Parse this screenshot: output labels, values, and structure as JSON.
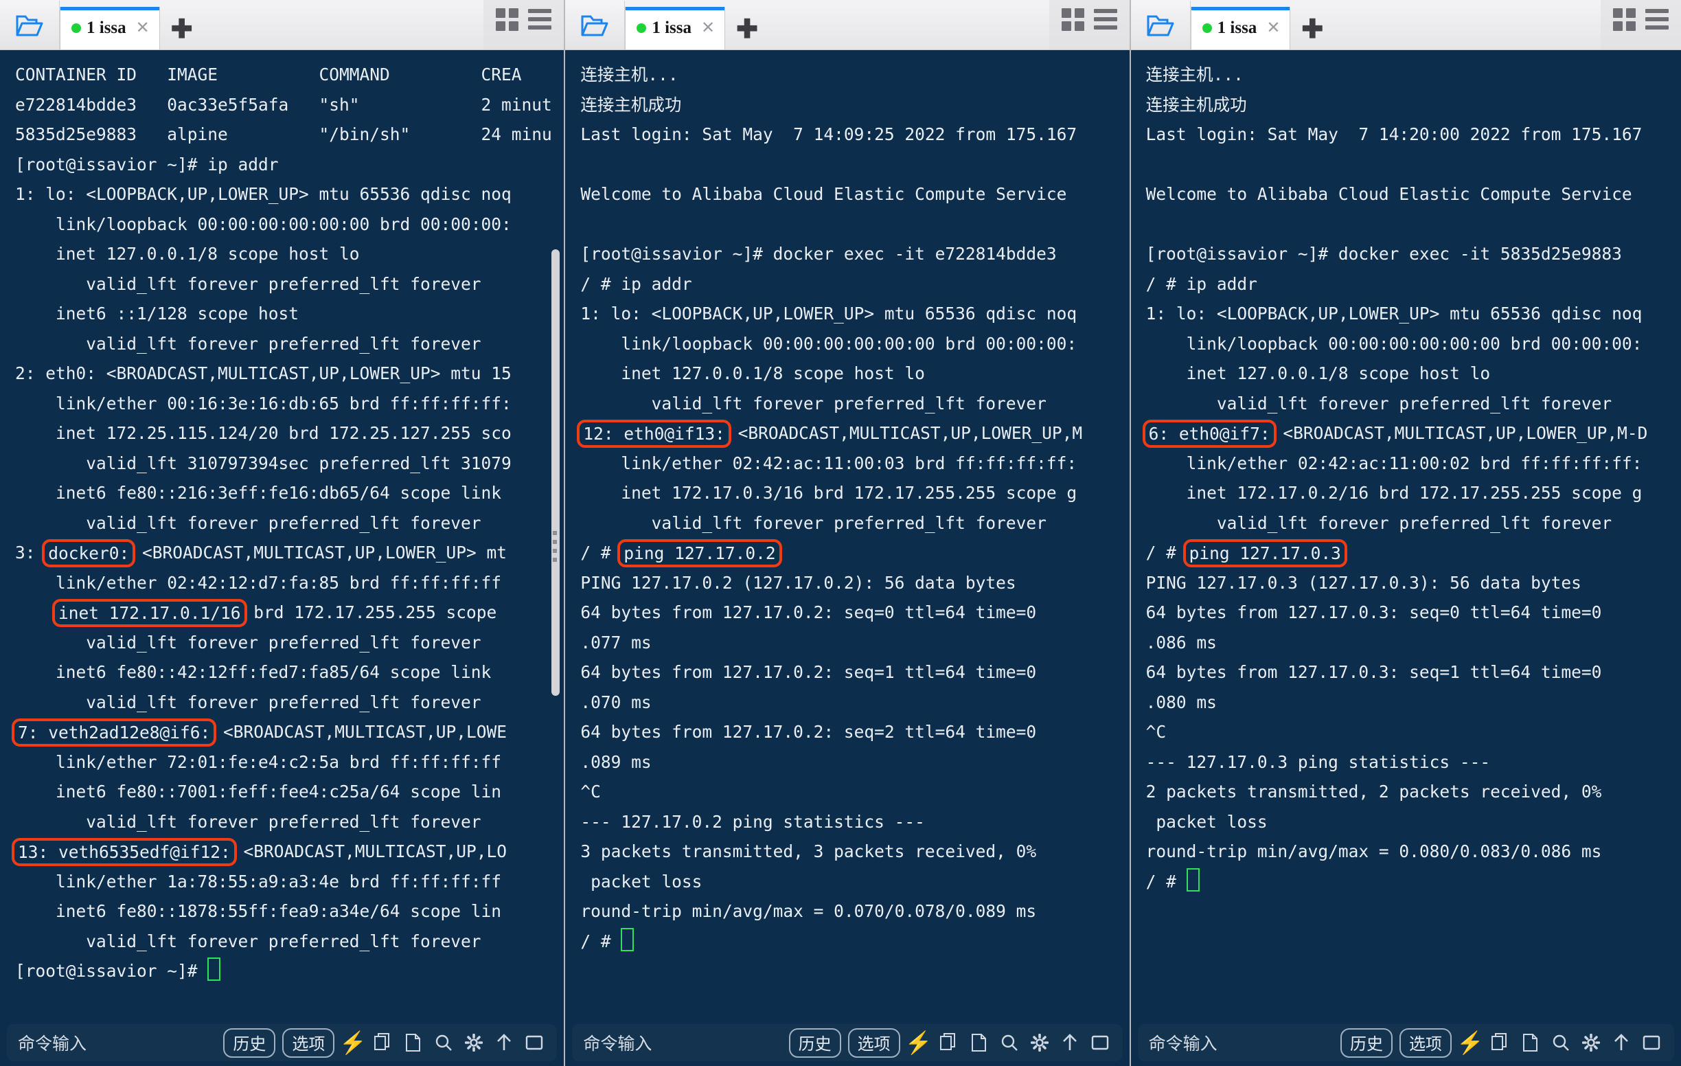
{
  "window": {
    "panel_count": 3
  },
  "tab": {
    "label": "1 issa",
    "close_glyph": "✕",
    "add_glyph": "✚",
    "folder_icon": "folder-open-icon",
    "dot_status": "connected",
    "accent_color": "#1a84f0",
    "status_color": "#1fd235"
  },
  "bottombar": {
    "placeholder": "命令输入",
    "history_label": "历史",
    "options_label": "选项",
    "icons": [
      "bolt-icon",
      "copy-icon",
      "paste-icon",
      "search-icon",
      "gear-icon",
      "upload-icon",
      "window-icon"
    ]
  },
  "panels": [
    {
      "id": "panel-host",
      "lines": [
        [
          {
            "t": "CONTAINER ID   IMAGE          COMMAND         CREA"
          }
        ],
        [
          {
            "t": "e722814bdde3   0ac33e5f5afa   \"sh\"            2 minut"
          }
        ],
        [
          {
            "t": "5835d25e9883   alpine         \"/bin/sh\"       24 minu"
          }
        ],
        [
          {
            "t": "[root@issavior ~]# ip addr"
          }
        ],
        [
          {
            "t": "1: lo: <LOOPBACK,UP,LOWER_UP> mtu 65536 qdisc noq"
          }
        ],
        [
          {
            "t": "    link/loopback 00:00:00:00:00:00 brd 00:00:00:"
          }
        ],
        [
          {
            "t": "    inet 127.0.0.1/8 scope host lo"
          }
        ],
        [
          {
            "t": "       valid_lft forever preferred_lft forever"
          }
        ],
        [
          {
            "t": "    inet6 ::1/128 scope host"
          }
        ],
        [
          {
            "t": "       valid_lft forever preferred_lft forever"
          }
        ],
        [
          {
            "t": "2: eth0: <BROADCAST,MULTICAST,UP,LOWER_UP> mtu 15"
          }
        ],
        [
          {
            "t": "    link/ether 00:16:3e:16:db:65 brd ff:ff:ff:ff:"
          }
        ],
        [
          {
            "t": "    inet 172.25.115.124/20 brd 172.25.127.255 sco"
          }
        ],
        [
          {
            "t": "       valid_lft 310797394sec preferred_lft 31079"
          }
        ],
        [
          {
            "t": "    inet6 fe80::216:3eff:fe16:db65/64 scope link"
          }
        ],
        [
          {
            "t": "       valid_lft forever preferred_lft forever"
          }
        ],
        [
          {
            "t": "3: "
          },
          {
            "t": "docker0:",
            "hl": true
          },
          {
            "t": " <BROADCAST,MULTICAST,UP,LOWER_UP> mt"
          }
        ],
        [
          {
            "t": "    link/ether 02:42:12:d7:fa:85 brd ff:ff:ff:ff"
          }
        ],
        [
          {
            "t": "    "
          },
          {
            "t": "inet 172.17.0.1/16",
            "hl": true
          },
          {
            "t": " brd 172.17.255.255 scope"
          }
        ],
        [
          {
            "t": "       valid_lft forever preferred_lft forever"
          }
        ],
        [
          {
            "t": "    inet6 fe80::42:12ff:fed7:fa85/64 scope link"
          }
        ],
        [
          {
            "t": "       valid_lft forever preferred_lft forever"
          }
        ],
        [
          {
            "t": "7: veth2ad12e8@if6:",
            "hl": true
          },
          {
            "t": " <BROADCAST,MULTICAST,UP,LOWE"
          }
        ],
        [
          {
            "t": "    link/ether 72:01:fe:e4:c2:5a brd ff:ff:ff:ff"
          }
        ],
        [
          {
            "t": "    inet6 fe80::7001:feff:fee4:c25a/64 scope lin"
          }
        ],
        [
          {
            "t": "       valid_lft forever preferred_lft forever"
          }
        ],
        [
          {
            "t": "13: veth6535edf@if12:",
            "hl": true
          },
          {
            "t": " <BROADCAST,MULTICAST,UP,LO"
          }
        ],
        [
          {
            "t": "    link/ether 1a:78:55:a9:a3:4e brd ff:ff:ff:ff"
          }
        ],
        [
          {
            "t": "    inet6 fe80::1878:55ff:fea9:a34e/64 scope lin"
          }
        ],
        [
          {
            "t": "       valid_lft forever preferred_lft forever"
          }
        ],
        [
          {
            "t": "[root@issavior ~]# "
          },
          {
            "cursor": true
          }
        ]
      ]
    },
    {
      "id": "panel-container-e722814bdde3",
      "lines": [
        [
          {
            "t": "连接主机..."
          }
        ],
        [
          {
            "t": "连接主机成功"
          }
        ],
        [
          {
            "t": "Last login: Sat May  7 14:09:25 2022 from 175.167"
          }
        ],
        [
          {
            "t": ""
          }
        ],
        [
          {
            "t": "Welcome to Alibaba Cloud Elastic Compute Service"
          }
        ],
        [
          {
            "t": ""
          }
        ],
        [
          {
            "t": "[root@issavior ~]# docker exec -it e722814bdde3"
          }
        ],
        [
          {
            "t": "/ # ip addr"
          }
        ],
        [
          {
            "t": "1: lo: <LOOPBACK,UP,LOWER_UP> mtu 65536 qdisc noq"
          }
        ],
        [
          {
            "t": "    link/loopback 00:00:00:00:00:00 brd 00:00:00:"
          }
        ],
        [
          {
            "t": "    inet 127.0.0.1/8 scope host lo"
          }
        ],
        [
          {
            "t": "       valid_lft forever preferred_lft forever"
          }
        ],
        [
          {
            "t": "12: eth0@if13:",
            "hl": true
          },
          {
            "t": " <BROADCAST,MULTICAST,UP,LOWER_UP,M"
          }
        ],
        [
          {
            "t": "    link/ether 02:42:ac:11:00:03 brd ff:ff:ff:ff:"
          }
        ],
        [
          {
            "t": "    inet 172.17.0.3/16 brd 172.17.255.255 scope g"
          }
        ],
        [
          {
            "t": "       valid_lft forever preferred_lft forever"
          }
        ],
        [
          {
            "t": "/ # "
          },
          {
            "t": "ping 127.17.0.2",
            "hl": true
          }
        ],
        [
          {
            "t": "PING 127.17.0.2 (127.17.0.2): 56 data bytes"
          }
        ],
        [
          {
            "t": "64 bytes from 127.17.0.2: seq=0 ttl=64 time=0"
          }
        ],
        [
          {
            "t": ".077 ms"
          }
        ],
        [
          {
            "t": "64 bytes from 127.17.0.2: seq=1 ttl=64 time=0"
          }
        ],
        [
          {
            "t": ".070 ms"
          }
        ],
        [
          {
            "t": "64 bytes from 127.17.0.2: seq=2 ttl=64 time=0"
          }
        ],
        [
          {
            "t": ".089 ms"
          }
        ],
        [
          {
            "t": "^C"
          }
        ],
        [
          {
            "t": "--- 127.17.0.2 ping statistics ---"
          }
        ],
        [
          {
            "t": "3 packets transmitted, 3 packets received, 0%"
          }
        ],
        [
          {
            "t": " packet loss"
          }
        ],
        [
          {
            "t": "round-trip min/avg/max = 0.070/0.078/0.089 ms"
          }
        ],
        [
          {
            "t": "/ # "
          },
          {
            "cursor": true
          }
        ]
      ]
    },
    {
      "id": "panel-container-5835d25e9883",
      "lines": [
        [
          {
            "t": "连接主机..."
          }
        ],
        [
          {
            "t": "连接主机成功"
          }
        ],
        [
          {
            "t": "Last login: Sat May  7 14:20:00 2022 from 175.167"
          }
        ],
        [
          {
            "t": ""
          }
        ],
        [
          {
            "t": "Welcome to Alibaba Cloud Elastic Compute Service"
          }
        ],
        [
          {
            "t": ""
          }
        ],
        [
          {
            "t": "[root@issavior ~]# docker exec -it 5835d25e9883"
          }
        ],
        [
          {
            "t": "/ # ip addr"
          }
        ],
        [
          {
            "t": "1: lo: <LOOPBACK,UP,LOWER_UP> mtu 65536 qdisc noq"
          }
        ],
        [
          {
            "t": "    link/loopback 00:00:00:00:00:00 brd 00:00:00:"
          }
        ],
        [
          {
            "t": "    inet 127.0.0.1/8 scope host lo"
          }
        ],
        [
          {
            "t": "       valid_lft forever preferred_lft forever"
          }
        ],
        [
          {
            "t": "6: eth0@if7:",
            "hl": true
          },
          {
            "t": " <BROADCAST,MULTICAST,UP,LOWER_UP,M-D"
          }
        ],
        [
          {
            "t": "    link/ether 02:42:ac:11:00:02 brd ff:ff:ff:ff:"
          }
        ],
        [
          {
            "t": "    inet 172.17.0.2/16 brd 172.17.255.255 scope g"
          }
        ],
        [
          {
            "t": "       valid_lft forever preferred_lft forever"
          }
        ],
        [
          {
            "t": "/ # "
          },
          {
            "t": "ping 127.17.0.3",
            "hl": true
          }
        ],
        [
          {
            "t": "PING 127.17.0.3 (127.17.0.3): 56 data bytes"
          }
        ],
        [
          {
            "t": "64 bytes from 127.17.0.3: seq=0 ttl=64 time=0"
          }
        ],
        [
          {
            "t": ".086 ms"
          }
        ],
        [
          {
            "t": "64 bytes from 127.17.0.3: seq=1 ttl=64 time=0"
          }
        ],
        [
          {
            "t": ".080 ms"
          }
        ],
        [
          {
            "t": "^C"
          }
        ],
        [
          {
            "t": "--- 127.17.0.3 ping statistics ---"
          }
        ],
        [
          {
            "t": "2 packets transmitted, 2 packets received, 0%"
          }
        ],
        [
          {
            "t": " packet loss"
          }
        ],
        [
          {
            "t": "round-trip min/avg/max = 0.080/0.083/0.086 ms"
          }
        ],
        [
          {
            "t": "/ # "
          },
          {
            "cursor": true
          }
        ]
      ]
    }
  ]
}
